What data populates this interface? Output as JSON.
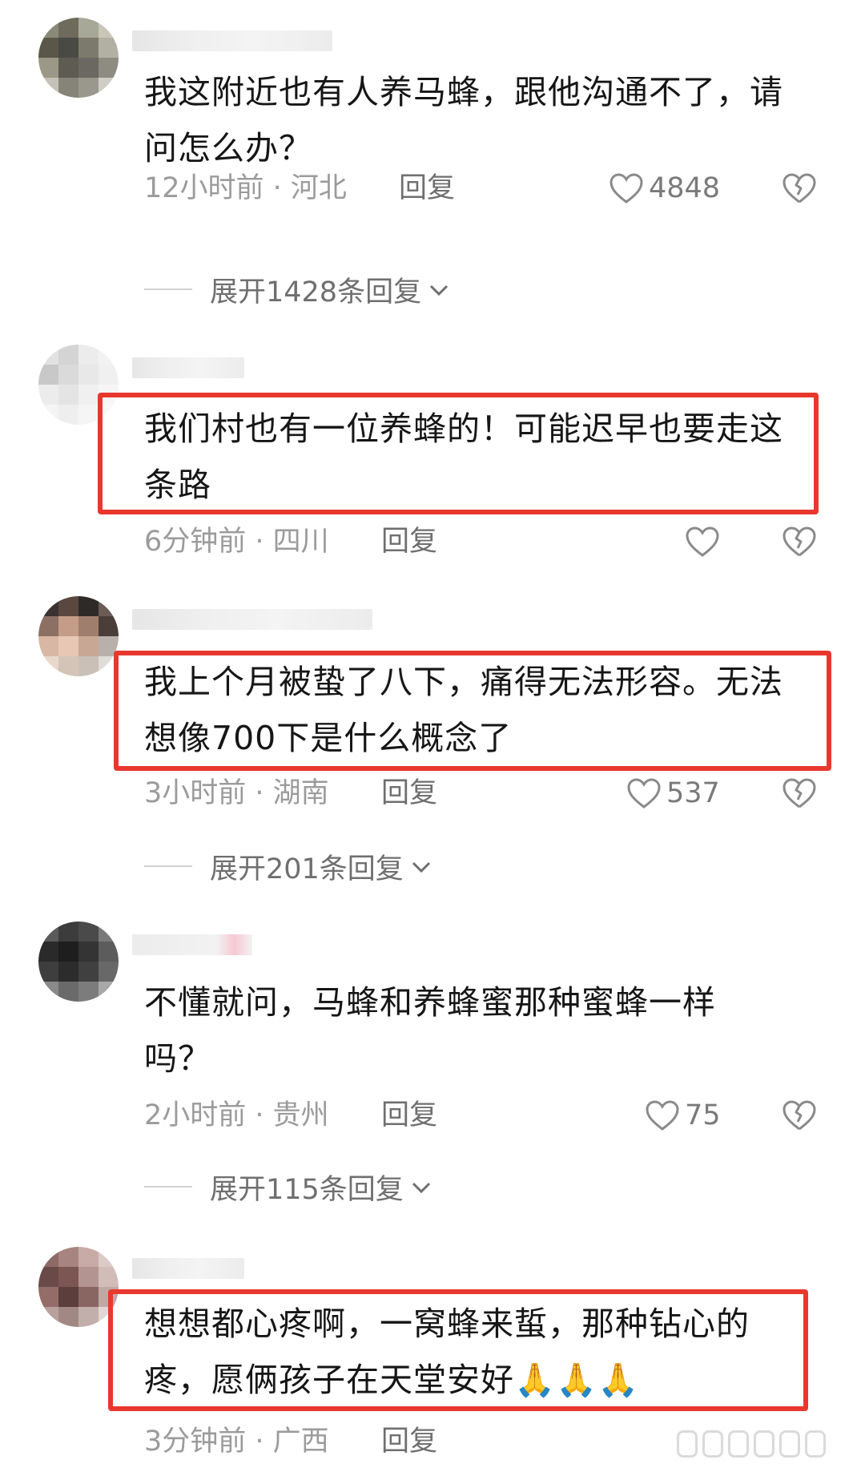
{
  "comments": [
    {
      "text": "我这附近也有人养马蜂，跟他沟通不了，请问怎么办？",
      "time": "12小时前",
      "location": "河北",
      "meta": "12小时前 · 河北",
      "reply_label": "回复",
      "likes": "4848",
      "expand_label": "展开1428条回复",
      "highlighted": false
    },
    {
      "text": "我们村也有一位养蜂的！可能迟早也要走这条路",
      "time": "6分钟前",
      "location": "四川",
      "meta": "6分钟前 · 四川",
      "reply_label": "回复",
      "likes": "",
      "highlighted": true
    },
    {
      "text": "我上个月被蛰了八下，痛得无法形容。无法想像700下是什么概念了",
      "time": "3小时前",
      "location": "湖南",
      "meta": "3小时前 · 湖南",
      "reply_label": "回复",
      "likes": "537",
      "expand_label": "展开201条回复",
      "highlighted": true
    },
    {
      "text": "不懂就问，马蜂和养蜂蜜那种蜜蜂一样吗？",
      "time": "2小时前",
      "location": "贵州",
      "meta": "2小时前 · 贵州",
      "reply_label": "回复",
      "likes": "75",
      "expand_label": "展开115条回复",
      "highlighted": false
    },
    {
      "text": "想想都心疼啊，一窝蜂来蜇，那种钻心的疼，愿俩孩子在天堂安好🙏🙏🙏",
      "time": "3分钟前",
      "location": "广西",
      "meta": "3分钟前 · 广西",
      "reply_label": "回复",
      "highlighted": true
    }
  ],
  "icons": {
    "like": "heart-outline-icon",
    "dislike": "broken-heart-icon",
    "expand": "chevron-down-icon"
  },
  "colors": {
    "highlight_border": "#e8382e",
    "meta_text": "#9b9b9b",
    "body_text": "#161616"
  }
}
